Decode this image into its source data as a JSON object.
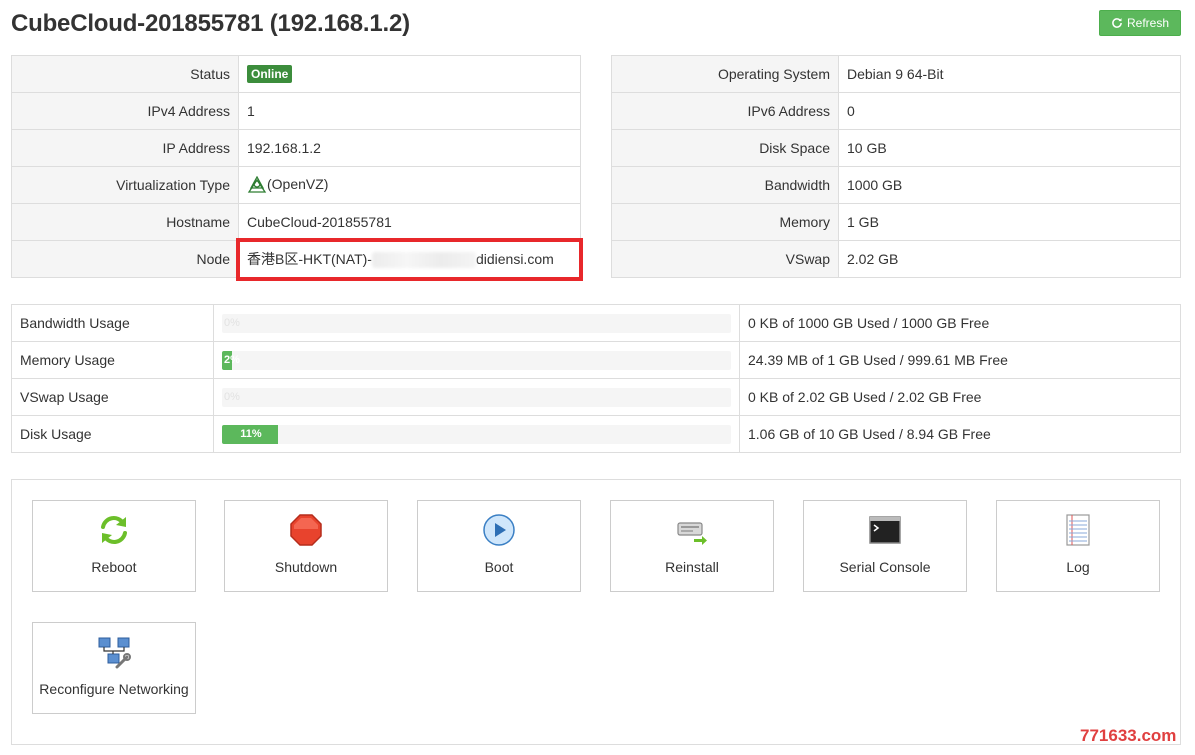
{
  "header": {
    "title": "CubeCloud-201855781 (192.168.1.2)",
    "refresh_label": "Refresh"
  },
  "left_info": [
    {
      "label": "Status",
      "value": "Online"
    },
    {
      "label": "IPv4 Address",
      "value": "1"
    },
    {
      "label": "IP Address",
      "value": "192.168.1.2"
    },
    {
      "label": "Virtualization Type",
      "value": "(OpenVZ)"
    },
    {
      "label": "Hostname",
      "value": "CubeCloud-201855781"
    },
    {
      "label": "Node",
      "value_prefix": "香港B区-HKT(NAT)-",
      "value_suffix": "didiensi.com"
    }
  ],
  "right_info": [
    {
      "label": "Operating System",
      "value": "Debian 9 64-Bit"
    },
    {
      "label": "IPv6 Address",
      "value": "0"
    },
    {
      "label": "Disk Space",
      "value": "10 GB"
    },
    {
      "label": "Bandwidth",
      "value": "1000 GB"
    },
    {
      "label": "Memory",
      "value": "1 GB"
    },
    {
      "label": "VSwap",
      "value": "2.02 GB"
    }
  ],
  "usage": [
    {
      "label": "Bandwidth Usage",
      "percent": 0,
      "percent_label": "0%",
      "detail": "0 KB of 1000 GB Used / 1000 GB Free"
    },
    {
      "label": "Memory Usage",
      "percent": 2,
      "percent_label": "2%",
      "detail": "24.39 MB of 1 GB Used / 999.61 MB Free"
    },
    {
      "label": "VSwap Usage",
      "percent": 0,
      "percent_label": "0%",
      "detail": "0 KB of 2.02 GB Used / 2.02 GB Free"
    },
    {
      "label": "Disk Usage",
      "percent": 11,
      "percent_label": "11%",
      "detail": "1.06 GB of 10 GB Used / 8.94 GB Free"
    }
  ],
  "actions": [
    {
      "label": "Reboot",
      "icon": "reboot-icon"
    },
    {
      "label": "Shutdown",
      "icon": "shutdown-icon"
    },
    {
      "label": "Boot",
      "icon": "boot-icon"
    },
    {
      "label": "Reinstall",
      "icon": "reinstall-icon"
    },
    {
      "label": "Serial Console",
      "icon": "serial-console-icon"
    },
    {
      "label": "Log",
      "icon": "log-icon"
    },
    {
      "label": "Reconfigure Networking",
      "icon": "network-icon"
    }
  ],
  "colors": {
    "accent_green": "#5cb85c",
    "online_badge": "#3c8d3c",
    "highlight_red": "#e8282b"
  },
  "watermark": "771633.com"
}
